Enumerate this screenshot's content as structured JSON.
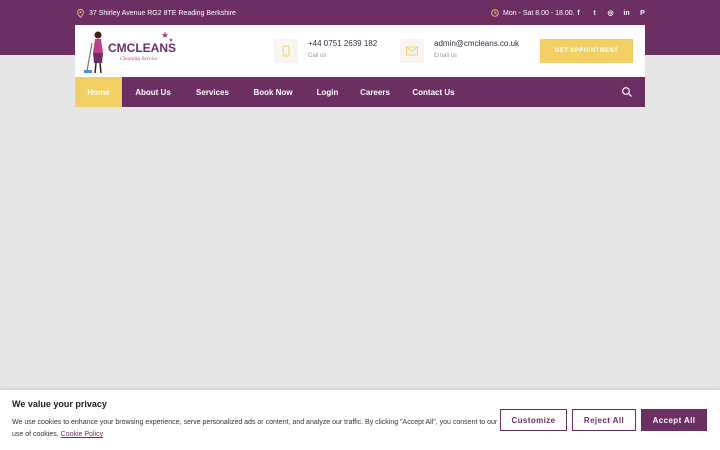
{
  "topbar": {
    "address": "37 Shirley Avenue RG2 8TE Reading Berkshire",
    "hours": "Mon - Sat 8.00 - 18.00.",
    "social": [
      {
        "icon": "facebook-icon",
        "glyph": "f"
      },
      {
        "icon": "twitter-icon",
        "glyph": "t"
      },
      {
        "icon": "instagram-icon",
        "glyph": "◎"
      },
      {
        "icon": "linkedin-icon",
        "glyph": "in"
      },
      {
        "icon": "pinterest-icon",
        "glyph": "P"
      }
    ]
  },
  "header": {
    "logo_text": "CMCLEANS",
    "logo_tagline": "Cleaning Service",
    "phone": {
      "value": "+44 0751 2639 182",
      "label": "Call us"
    },
    "email": {
      "value": "admin@cmcleans.co.uk",
      "label": "Email us"
    },
    "appointment_button": "GET APPOINTMENT"
  },
  "nav": {
    "items": [
      {
        "label": "Home",
        "active": true
      },
      {
        "label": "About Us",
        "active": false
      },
      {
        "label": "Services",
        "active": false
      },
      {
        "label": "Book Now",
        "active": false
      },
      {
        "label": "Login",
        "active": false
      },
      {
        "label": "Careers",
        "active": false
      },
      {
        "label": "Contact Us",
        "active": false
      }
    ]
  },
  "cookie": {
    "title": "We value your privacy",
    "text": "We use cookies to enhance your browsing experience, serve personalized ads or content, and analyze our traffic. By clicking \"Accept All\", you consent to our use of cookies.",
    "link": "Cookie Policy",
    "customize": "Customize",
    "reject": "Reject All",
    "accept": "Accept All"
  },
  "colors": {
    "brand_purple": "#6b2f64",
    "accent_yellow": "#f2cf62",
    "page_bg": "#e6e6e6"
  }
}
